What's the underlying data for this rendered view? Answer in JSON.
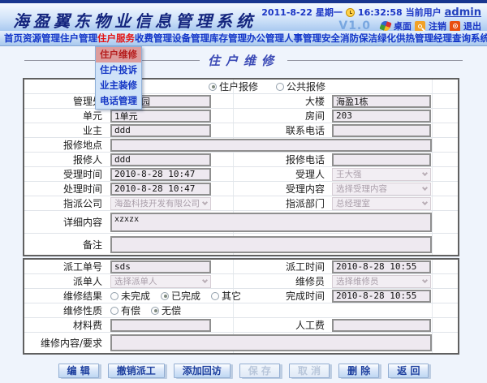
{
  "colors": {
    "accent_blue": "#1336c9",
    "active_red": "#e51414",
    "header_navy": "#14257e",
    "button_text": "#1d3f9e"
  },
  "header": {
    "app_title": "海盈翼东物业信息管理系统",
    "date": "2011-8-22",
    "weekday": "星期一",
    "time": "16:32:58",
    "current_user_label": "当前用户",
    "username": "admin",
    "version": "V1.0",
    "desktop_label": "桌面",
    "logout_label": "注销",
    "exit_label": "退出"
  },
  "nav": {
    "items": [
      {
        "label": "首页",
        "active": false
      },
      {
        "label": "资源管理",
        "active": false
      },
      {
        "label": "住户管理",
        "active": false
      },
      {
        "label": "住户服务",
        "active": true
      },
      {
        "label": "收费管理",
        "active": false
      },
      {
        "label": "设备管理",
        "active": false
      },
      {
        "label": "库存管理",
        "active": false
      },
      {
        "label": "办公管理",
        "active": false
      },
      {
        "label": "人事管理",
        "active": false
      },
      {
        "label": "安全消防",
        "active": false
      },
      {
        "label": "保洁绿化",
        "active": false
      },
      {
        "label": "供热管理",
        "active": false
      },
      {
        "label": "经理查询",
        "active": false
      },
      {
        "label": "系统维护",
        "active": false
      }
    ]
  },
  "menu": {
    "items": [
      "住户维修",
      "住户投诉",
      "业主装修",
      "电话管理"
    ],
    "active": "住户维修"
  },
  "page": {
    "title": "住户维修"
  },
  "form": {
    "report_type": {
      "options": [
        "住户报修",
        "公共报修"
      ],
      "selected": "住户报修"
    },
    "fields": {
      "mgmt_office": {
        "label": "管理处",
        "value": "海盈花园"
      },
      "building": {
        "label": "大楼",
        "value": "海盈1栋"
      },
      "unit": {
        "label": "单元",
        "value": "1单元"
      },
      "room": {
        "label": "房间",
        "value": "203"
      },
      "owner": {
        "label": "业主",
        "value": "ddd"
      },
      "contact_phone": {
        "label": "联系电话",
        "value": ""
      },
      "repair_location": {
        "label": "报修地点",
        "value": ""
      },
      "reporter": {
        "label": "报修人",
        "value": "ddd"
      },
      "report_phone": {
        "label": "报修电话",
        "value": ""
      },
      "accept_time": {
        "label": "受理时间",
        "value": "2010-8-28 10:47"
      },
      "acceptor": {
        "label": "受理人",
        "value": "王大强"
      },
      "process_time": {
        "label": "处理时间",
        "value": "2010-8-28 10:47"
      },
      "accept_content": {
        "label": "受理内容",
        "value": "选择受理内容"
      },
      "assigned_company": {
        "label": "指派公司",
        "value": "海盈科技开发有限公司"
      },
      "assigned_dept": {
        "label": "指派部门",
        "value": "总经理室"
      },
      "detail_content": {
        "label": "详细内容",
        "value": "xzxzx"
      },
      "remark": {
        "label": "备注",
        "value": ""
      },
      "work_order_no": {
        "label": "派工单号",
        "value": "sds"
      },
      "dispatch_time": {
        "label": "派工时间",
        "value": "2010-8-28 10:55"
      },
      "dispatcher": {
        "label": "派单人",
        "value": "选择派单人"
      },
      "repairman": {
        "label": "维修员",
        "value": "选择维修员"
      },
      "repair_result": {
        "label": "维修结果",
        "options": [
          "未完成",
          "已完成",
          "其它"
        ],
        "selected": "已完成"
      },
      "complete_time": {
        "label": "完成时间",
        "value": "2010-8-28 10:55"
      },
      "repair_nature": {
        "label": "维修性质",
        "options": [
          "有偿",
          "无偿"
        ],
        "selected": "无偿"
      },
      "material_fee": {
        "label": "材料费",
        "value": ""
      },
      "labor_fee": {
        "label": "人工费",
        "value": ""
      },
      "repair_request": {
        "label": "维修内容/要求",
        "value": ""
      }
    }
  },
  "buttons": [
    {
      "label": "编 辑",
      "enabled": true
    },
    {
      "label": "撤销派工",
      "enabled": true
    },
    {
      "label": "添加回访",
      "enabled": true
    },
    {
      "label": "保 存",
      "enabled": false
    },
    {
      "label": "取 消",
      "enabled": false
    },
    {
      "label": "删 除",
      "enabled": true
    },
    {
      "label": "返 回",
      "enabled": true
    }
  ]
}
